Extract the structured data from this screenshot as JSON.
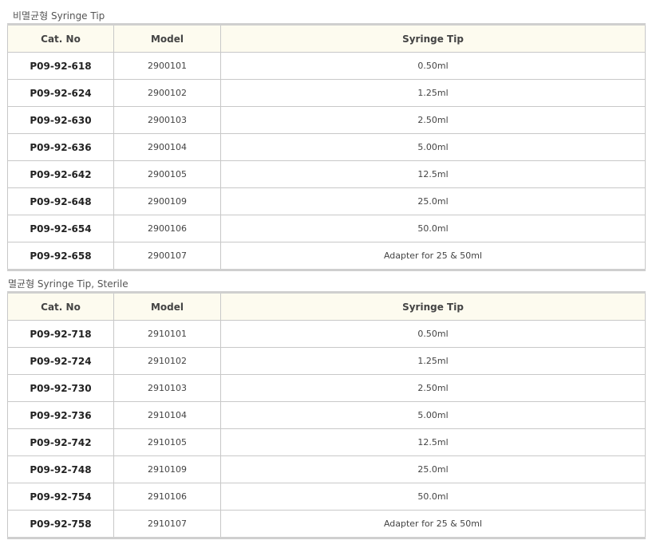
{
  "sections": [
    {
      "title": "비멸균형 Syringe Tip",
      "headers": [
        "Cat. No",
        "Model",
        "Syringe Tip"
      ],
      "rows": [
        {
          "cat": "P09-92-618",
          "model": "2900101",
          "tip": "0.50ml"
        },
        {
          "cat": "P09-92-624",
          "model": "2900102",
          "tip": "1.25ml"
        },
        {
          "cat": "P09-92-630",
          "model": "2900103",
          "tip": "2.50ml"
        },
        {
          "cat": "P09-92-636",
          "model": "2900104",
          "tip": "5.00ml"
        },
        {
          "cat": "P09-92-642",
          "model": "2900105",
          "tip": "12.5ml"
        },
        {
          "cat": "P09-92-648",
          "model": "2900109",
          "tip": "25.0ml"
        },
        {
          "cat": "P09-92-654",
          "model": "2900106",
          "tip": "50.0ml"
        },
        {
          "cat": "P09-92-658",
          "model": "2900107",
          "tip": "Adapter for 25 & 50ml"
        }
      ]
    },
    {
      "title": "멸균형 Syringe Tip, Sterile",
      "headers": [
        "Cat. No",
        "Model",
        "Syringe Tip"
      ],
      "rows": [
        {
          "cat": "P09-92-718",
          "model": "2910101",
          "tip": "0.50ml"
        },
        {
          "cat": "P09-92-724",
          "model": "2910102",
          "tip": "1.25ml"
        },
        {
          "cat": "P09-92-730",
          "model": "2910103",
          "tip": "2.50ml"
        },
        {
          "cat": "P09-92-736",
          "model": "2910104",
          "tip": "5.00ml"
        },
        {
          "cat": "P09-92-742",
          "model": "2910105",
          "tip": "12.5ml"
        },
        {
          "cat": "P09-92-748",
          "model": "2910109",
          "tip": "25.0ml"
        },
        {
          "cat": "P09-92-754",
          "model": "2910106",
          "tip": "50.0ml"
        },
        {
          "cat": "P09-92-758",
          "model": "2910107",
          "tip": "Adapter for 25 & 50ml"
        }
      ]
    }
  ]
}
